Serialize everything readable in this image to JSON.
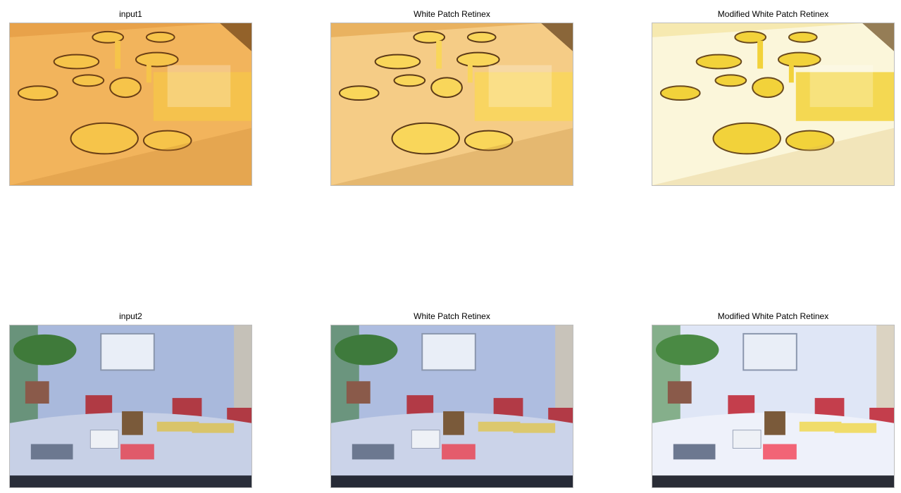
{
  "panels": [
    {
      "title": "input1"
    },
    {
      "title": "White Patch Retinex"
    },
    {
      "title": "Modified White Patch Retinex"
    },
    {
      "title": "input2"
    },
    {
      "title": "White Patch Retinex"
    },
    {
      "title": "Modified White Patch Retinex"
    }
  ],
  "scenes": {
    "table_setting": {
      "input1": {
        "base": "#e8a24a",
        "table": "#f2b45c",
        "shadow": "#c17a2a",
        "accent": "#f6c44a",
        "dark": "#6b3f16"
      },
      "white_patch": {
        "base": "#e9b260",
        "table": "#f5cc86",
        "shadow": "#b87a2e",
        "accent": "#f9d65a",
        "dark": "#5c3a18"
      },
      "modified": {
        "base": "#f6e9b0",
        "table": "#fbf6da",
        "shadow": "#d9b35a",
        "accent": "#f2d23a",
        "dark": "#6a4a1e"
      }
    },
    "office": {
      "input2": {
        "wall": "#a9b9dc",
        "table": "#c7d0e6",
        "floor": "#2a2e3a",
        "chair": "#b03a44",
        "plant": "#3f7a3a",
        "folder": "#d9c46a",
        "red": "#e05a6a"
      },
      "white_patch": {
        "wall": "#aebde0",
        "table": "#cbd3e9",
        "floor": "#262a36",
        "chair": "#b23a46",
        "plant": "#3e7a3c",
        "folder": "#dcc86e",
        "red": "#e45c6c"
      },
      "modified": {
        "wall": "#dfe6f6",
        "table": "#eef1fa",
        "floor": "#2a2d36",
        "chair": "#c43e4c",
        "plant": "#4a8a44",
        "folder": "#f0dc6a",
        "red": "#f26476"
      }
    }
  }
}
